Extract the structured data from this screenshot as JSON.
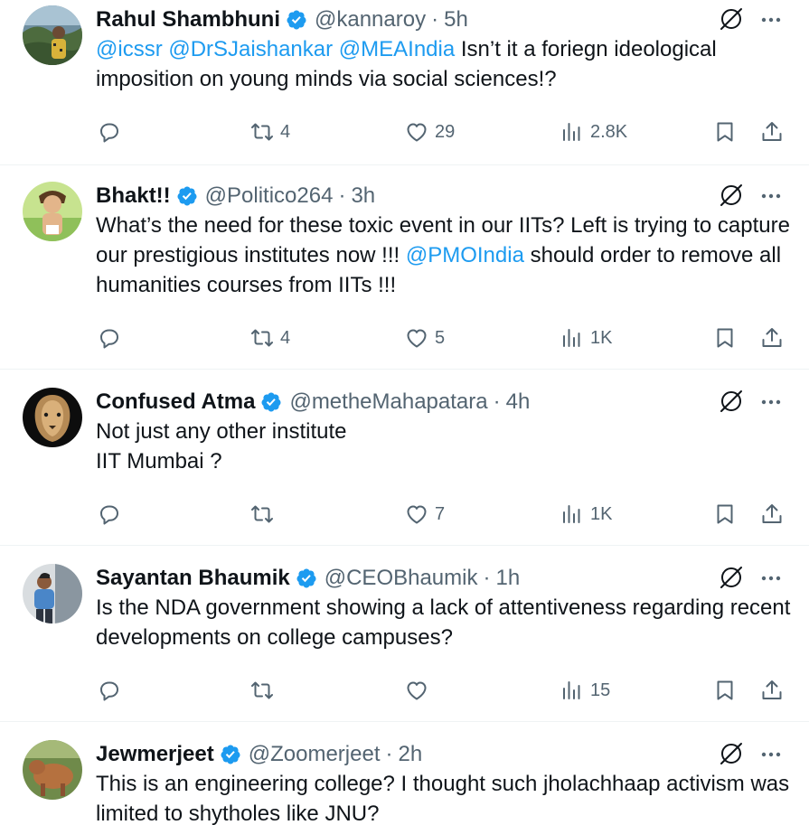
{
  "colors": {
    "link": "#1d9bf0",
    "verified": "#1d9bf0",
    "secondary_text": "#536471",
    "primary_text": "#0f1419",
    "divider": "#eff3f4"
  },
  "tweets": [
    {
      "name": "Rahul Shambhuni",
      "handle": "@kannaroy",
      "dot": "·",
      "time": "5h",
      "body_parts": [
        {
          "text": "@icssr @DrSJaishankar @MEAIndia",
          "mention": true
        },
        {
          "text": " Isn’t it a foriegn ideological imposition on young minds via social sciences!?",
          "mention": false
        }
      ],
      "stats": {
        "replies": "",
        "retweets": "4",
        "likes": "29",
        "views": "2.8K"
      }
    },
    {
      "name": "Bhakt!!",
      "handle": "@Politico264",
      "dot": "·",
      "time": "3h",
      "body_parts": [
        {
          "text": "What’s the need for these toxic event in our IITs? Left is trying to capture our prestigious institutes now !!! ",
          "mention": false
        },
        {
          "text": "@PMOIndia",
          "mention": true
        },
        {
          "text": " should order to remove all humanities courses from IITs !!!",
          "mention": false
        }
      ],
      "stats": {
        "replies": "",
        "retweets": "4",
        "likes": "5",
        "views": "1K"
      }
    },
    {
      "name": "Confused Atma",
      "handle": "@metheMahapatara",
      "dot": "·",
      "time": "4h",
      "body_lines": [
        "Not just any other institute",
        "IIT Mumbai ?"
      ],
      "stats": {
        "replies": "",
        "retweets": "",
        "likes": "7",
        "views": "1K"
      }
    },
    {
      "name": "Sayantan Bhaumik",
      "handle": "@CEOBhaumik",
      "dot": "·",
      "time": "1h",
      "body_parts": [
        {
          "text": "Is the NDA government showing a lack of attentiveness regarding recent developments on college campuses?",
          "mention": false
        }
      ],
      "stats": {
        "replies": "",
        "retweets": "",
        "likes": "",
        "views": "15"
      }
    },
    {
      "name": "Jewmerjeet",
      "handle": "@Zoomerjeet",
      "dot": "·",
      "time": "2h",
      "body_parts": [
        {
          "text": "This is an engineering college? I thought such jholachhaap activism was limited to shytholes like JNU?",
          "mention": false
        }
      ],
      "stats": {
        "replies": "",
        "retweets": "",
        "likes": "",
        "views": ""
      }
    }
  ]
}
